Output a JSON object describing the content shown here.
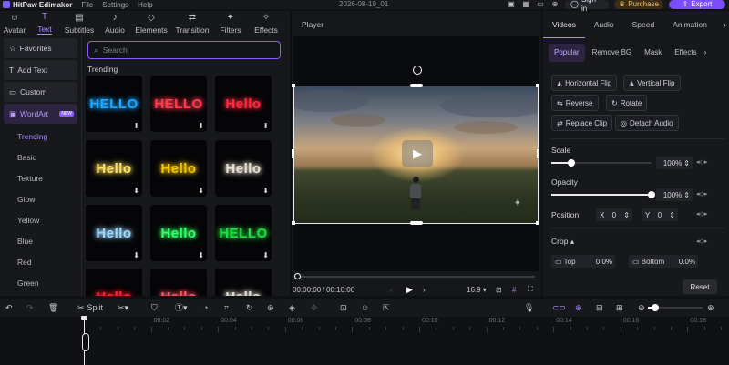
{
  "titlebar": {
    "app_name": "HitPaw Edimakor",
    "menu": [
      "File",
      "Settings",
      "Help"
    ],
    "date": "2026-08-19_01",
    "sign_in": "Sign in",
    "purchase": "Purchase",
    "export": "Export"
  },
  "tooltabs": [
    {
      "label": "Avatar",
      "icon": "avatar-icon",
      "glyph": "☺"
    },
    {
      "label": "Text",
      "icon": "text-icon",
      "glyph": "T",
      "active": true
    },
    {
      "label": "Subtitles",
      "icon": "subtitles-icon",
      "glyph": "▤"
    },
    {
      "label": "Audio",
      "icon": "audio-icon",
      "glyph": "♪"
    },
    {
      "label": "Elements",
      "icon": "elements-icon",
      "glyph": "◇"
    },
    {
      "label": "Transition",
      "icon": "transition-icon",
      "glyph": "⇄"
    },
    {
      "label": "Filters",
      "icon": "filters-icon",
      "glyph": "✦"
    },
    {
      "label": "Effects",
      "icon": "effects-icon",
      "glyph": "✧"
    }
  ],
  "categories": {
    "favorites": "Favorites",
    "add_text": "Add Text",
    "custom": "Custom",
    "wordart": "WordArt",
    "new_badge": "NEW",
    "subs": [
      "Trending",
      "Basic",
      "Texture",
      "Glow",
      "Yellow",
      "Blue",
      "Red",
      "Green"
    ]
  },
  "assets": {
    "search_placeholder": "Search",
    "section": "Trending",
    "tiles": [
      {
        "text": "HELLO",
        "color": "#1ea7ff"
      },
      {
        "text": "HELLO",
        "color": "#ff3b4f"
      },
      {
        "text": "Hello",
        "color": "#ff2a3d"
      },
      {
        "text": "Hello",
        "color": "#ffe066"
      },
      {
        "text": "Hello",
        "color": "#f5c400"
      },
      {
        "text": "Hello",
        "color": "#e8e2d0"
      },
      {
        "text": "Hello",
        "color": "#9fd8ff"
      },
      {
        "text": "Hello",
        "color": "#33ff66"
      },
      {
        "text": "HELLO",
        "color": "#22dd44"
      },
      {
        "text": "Hello",
        "color": "#ff2233"
      },
      {
        "text": "Hello",
        "color": "#ff5566"
      },
      {
        "text": "Hello",
        "color": "#e4e0cf"
      }
    ]
  },
  "player": {
    "title": "Player",
    "time_current": "00:00:00",
    "time_total": "00:10:00",
    "ratio": "16:9"
  },
  "props": {
    "tabs": [
      "Videos",
      "Audio",
      "Speed",
      "Animation"
    ],
    "subtabs": [
      "Popular",
      "Remove BG",
      "Mask",
      "Effects"
    ],
    "actions": {
      "hflip": "Horizontal Flip",
      "vflip": "Vertical Flip",
      "reverse": "Reverse",
      "rotate": "Rotate",
      "replace": "Replace Clip",
      "detach": "Detach Audio"
    },
    "scale_label": "Scale",
    "scale_value": "100%",
    "scale_fraction": 0.2,
    "opacity_label": "Opacity",
    "opacity_value": "100%",
    "opacity_fraction": 1.0,
    "position_label": "Position",
    "pos_x_label": "X",
    "pos_x": "0",
    "pos_y_label": "Y",
    "pos_y": "0",
    "crop_label": "Crop",
    "crop_top_label": "Top",
    "crop_top": "0.0%",
    "crop_bottom_label": "Bottom",
    "crop_bottom": "0.0%",
    "reset": "Reset"
  },
  "timeline": {
    "split_label": "Split",
    "ruler": [
      "00:00",
      "00:02",
      "00:04",
      "00:06",
      "00:08",
      "00:10",
      "00:12",
      "00:14",
      "00:16",
      "00:18"
    ]
  },
  "colors": {
    "accent": "#8b5cf6",
    "export": "#7a4dff",
    "purchase_text": "#f2c063"
  }
}
